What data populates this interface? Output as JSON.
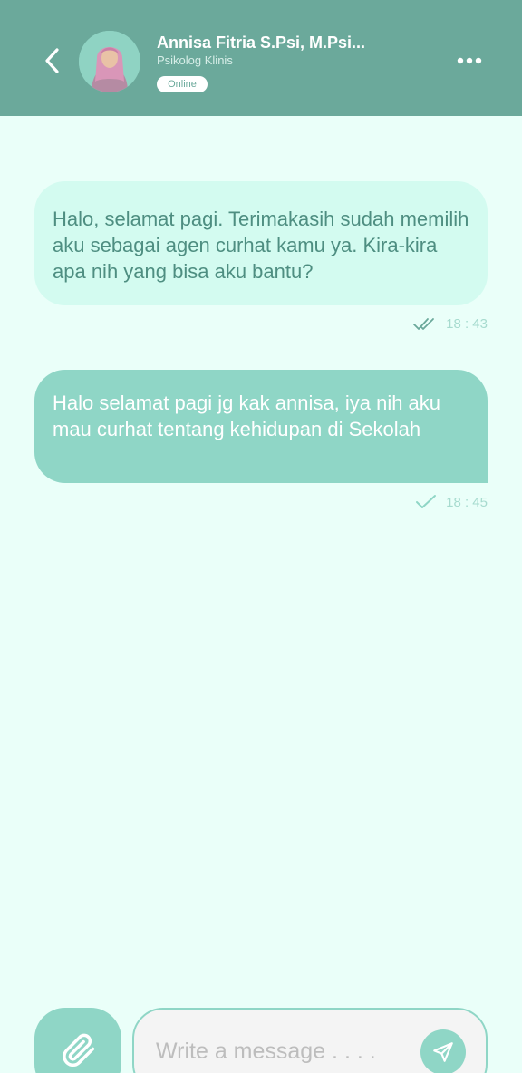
{
  "header": {
    "contact_name": "Annisa Fitria S.Psi, M.Psi...",
    "contact_role": "Psikolog Klinis",
    "status": "Online",
    "back_icon": "chevron-left-icon",
    "more_icon": "more-horizontal-icon"
  },
  "messages": [
    {
      "direction": "incoming",
      "text": "Halo, selamat pagi. Terimakasih sudah memilih aku sebagai agen curhat kamu ya. Kira-kira apa nih yang bisa aku bantu?",
      "time": "18 : 43",
      "status_icon": "double-check-icon"
    },
    {
      "direction": "outgoing",
      "text": "Halo selamat pagi jg kak annisa, iya nih aku mau curhat tentang kehidupan di Sekolah",
      "time": "18 : 45",
      "status_icon": "check-icon"
    }
  ],
  "composer": {
    "placeholder": "Write a message . . . .",
    "value": "",
    "attach_icon": "paperclip-icon",
    "send_icon": "send-icon"
  },
  "colors": {
    "header": "#6BA99B",
    "background": "#EAFFF9",
    "incoming_bubble": "#D3FBF0",
    "outgoing_bubble": "#8FD6C6",
    "accent": "#8FD6C6"
  }
}
